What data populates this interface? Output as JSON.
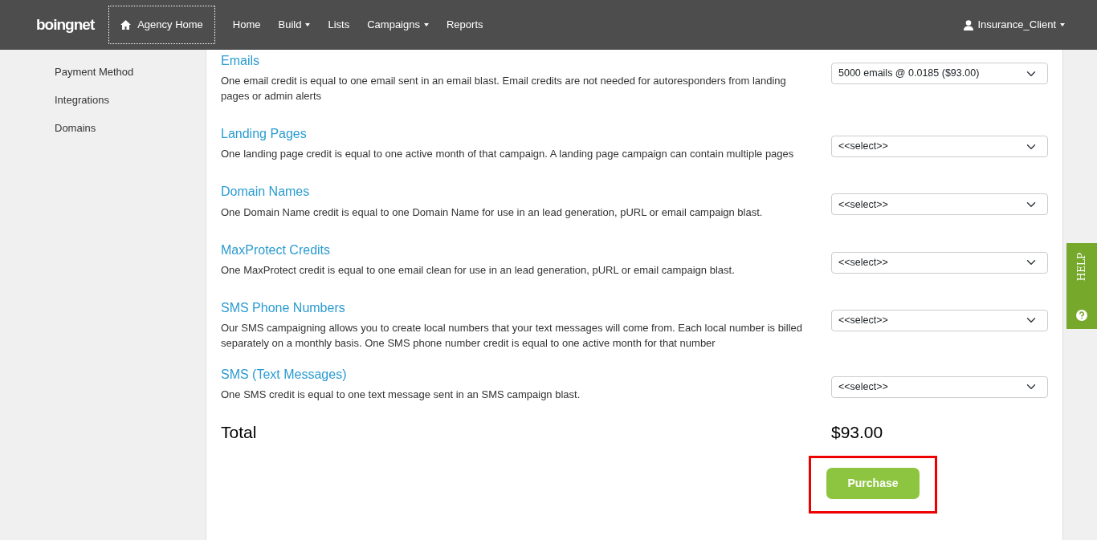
{
  "logo": "boingnet",
  "nav": {
    "agency_home": "Agency Home",
    "items": [
      {
        "label": "Home",
        "dropdown": false
      },
      {
        "label": "Build",
        "dropdown": true
      },
      {
        "label": "Lists",
        "dropdown": false
      },
      {
        "label": "Campaigns",
        "dropdown": true
      },
      {
        "label": "Reports",
        "dropdown": false
      }
    ],
    "user": "Insurance_Client"
  },
  "sidebar": {
    "items": [
      {
        "label": "Payment Method"
      },
      {
        "label": "Integrations"
      },
      {
        "label": "Domains"
      }
    ]
  },
  "products": [
    {
      "title": "Emails",
      "description": "One email credit is equal to one email sent in an email blast. Email credits are not needed for autoresponders from landing pages or admin alerts",
      "value": "5000 emails @ 0.0185 ($93.00)"
    },
    {
      "title": "Landing Pages",
      "description": "One landing page credit is equal to one active month of that campaign. A landing page campaign can contain multiple pages",
      "value": "<<select>>"
    },
    {
      "title": "Domain Names",
      "description": "One Domain Name credit is equal to one Domain Name for use in an lead generation, pURL or email campaign blast.",
      "value": "<<select>>"
    },
    {
      "title": "MaxProtect Credits",
      "description": "One MaxProtect credit is equal to one email clean for use in an lead generation, pURL or email campaign blast.",
      "value": "<<select>>"
    },
    {
      "title": "SMS Phone Numbers",
      "description": "Our SMS campaigning allows you to create local numbers that your text messages will come from. Each local number is billed separately on a monthly basis. One SMS phone number credit is equal to one active month for that number",
      "value": "<<select>>"
    },
    {
      "title": "SMS (Text Messages)",
      "description": "One SMS credit is equal to one text message sent in an SMS campaign blast.",
      "value": "<<select>>"
    }
  ],
  "total": {
    "label": "Total",
    "amount": "$93.00"
  },
  "purchase": {
    "label": "Purchase",
    "highlighted": true
  },
  "help_tab": {
    "label": "HELP"
  }
}
